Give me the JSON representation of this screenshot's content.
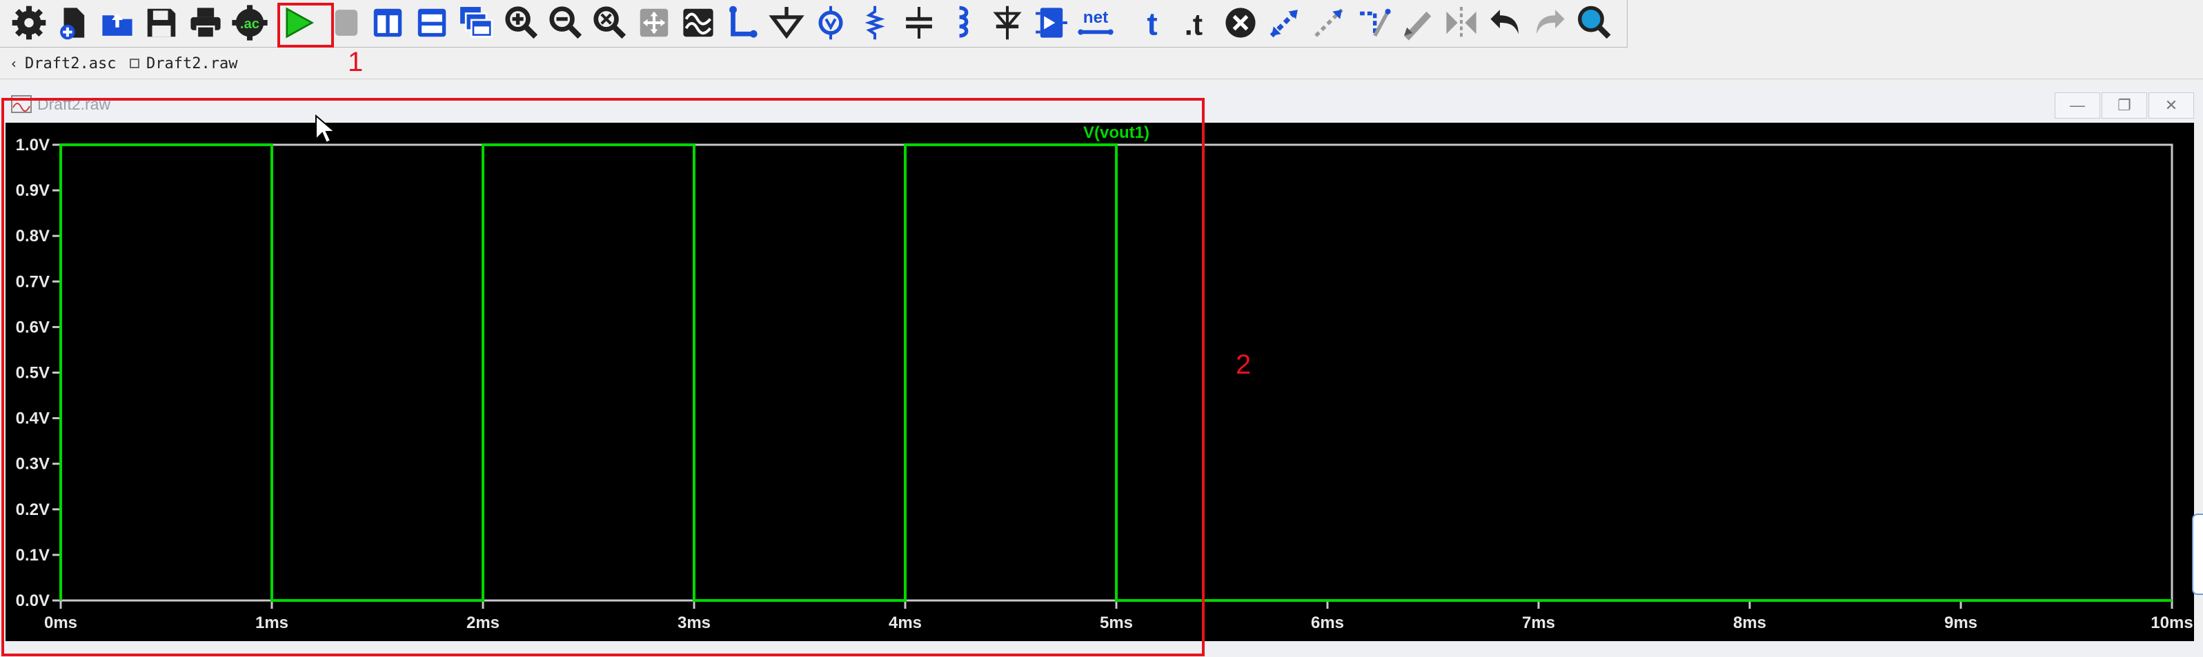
{
  "toolbar": {
    "buttons": [
      {
        "name": "settings-icon"
      },
      {
        "name": "new-schematic-icon"
      },
      {
        "name": "open-icon"
      },
      {
        "name": "save-icon"
      },
      {
        "name": "print-icon"
      },
      {
        "name": "edit-simulation-command-icon",
        "text": ".ac"
      },
      {
        "name": "run-icon"
      },
      {
        "name": "halt-icon"
      },
      {
        "name": "tile-vertical-icon"
      },
      {
        "name": "tile-horizontal-icon"
      },
      {
        "name": "cascade-windows-icon"
      },
      {
        "name": "zoom-in-icon"
      },
      {
        "name": "zoom-out-icon"
      },
      {
        "name": "zoom-fit-icon"
      },
      {
        "name": "pan-icon"
      },
      {
        "name": "waveform-icon"
      },
      {
        "name": "wire-icon"
      },
      {
        "name": "ground-icon"
      },
      {
        "name": "voltage-source-icon"
      },
      {
        "name": "resistor-icon"
      },
      {
        "name": "capacitor-icon"
      },
      {
        "name": "inductor-icon"
      },
      {
        "name": "diode-icon"
      },
      {
        "name": "component-icon"
      },
      {
        "name": "net-label-icon",
        "text": "net"
      },
      {
        "name": "text-icon",
        "text": "t"
      },
      {
        "name": "spice-directive-icon",
        "text": ".t"
      },
      {
        "name": "delete-icon"
      },
      {
        "name": "duplicate-icon"
      },
      {
        "name": "move-icon"
      },
      {
        "name": "drag-icon"
      },
      {
        "name": "draw-icon"
      },
      {
        "name": "mirror-icon"
      },
      {
        "name": "undo-icon"
      },
      {
        "name": "redo-icon"
      },
      {
        "name": "find-icon"
      }
    ]
  },
  "tabs": [
    {
      "label": "Draft2.asc",
      "icon": "back-arrow-icon"
    },
    {
      "label": "Draft2.raw",
      "icon": "waveform-doc-icon"
    }
  ],
  "waveform_window": {
    "title": "Draft2.raw",
    "controls": {
      "minimize": "—",
      "restore": "❐",
      "close": "✕"
    }
  },
  "annotations": {
    "box1": "1",
    "box2": "2"
  },
  "colors": {
    "trace": "#00d800",
    "grid": "#c8c8c8",
    "plot_bg": "#000000",
    "annotation": "#e8121e",
    "icon_blue": "#1a50d8"
  },
  "chart_data": {
    "type": "line",
    "trace_label": "V(vout1)",
    "x_ticks": [
      "0ms",
      "1ms",
      "2ms",
      "3ms",
      "4ms",
      "5ms",
      "6ms",
      "7ms",
      "8ms",
      "9ms",
      "10ms"
    ],
    "y_ticks": [
      "0.0V",
      "0.1V",
      "0.2V",
      "0.3V",
      "0.4V",
      "0.5V",
      "0.6V",
      "0.7V",
      "0.8V",
      "0.9V",
      "1.0V"
    ],
    "xlim": [
      0,
      10
    ],
    "ylim": [
      0,
      1
    ],
    "series": [
      {
        "name": "V(vout1)",
        "x": [
          0,
          0,
          1,
          1,
          2,
          2,
          3,
          3,
          4,
          4,
          5,
          5,
          10
        ],
        "y": [
          0,
          1,
          1,
          0,
          0,
          1,
          1,
          0,
          0,
          1,
          1,
          0,
          0
        ]
      }
    ]
  }
}
